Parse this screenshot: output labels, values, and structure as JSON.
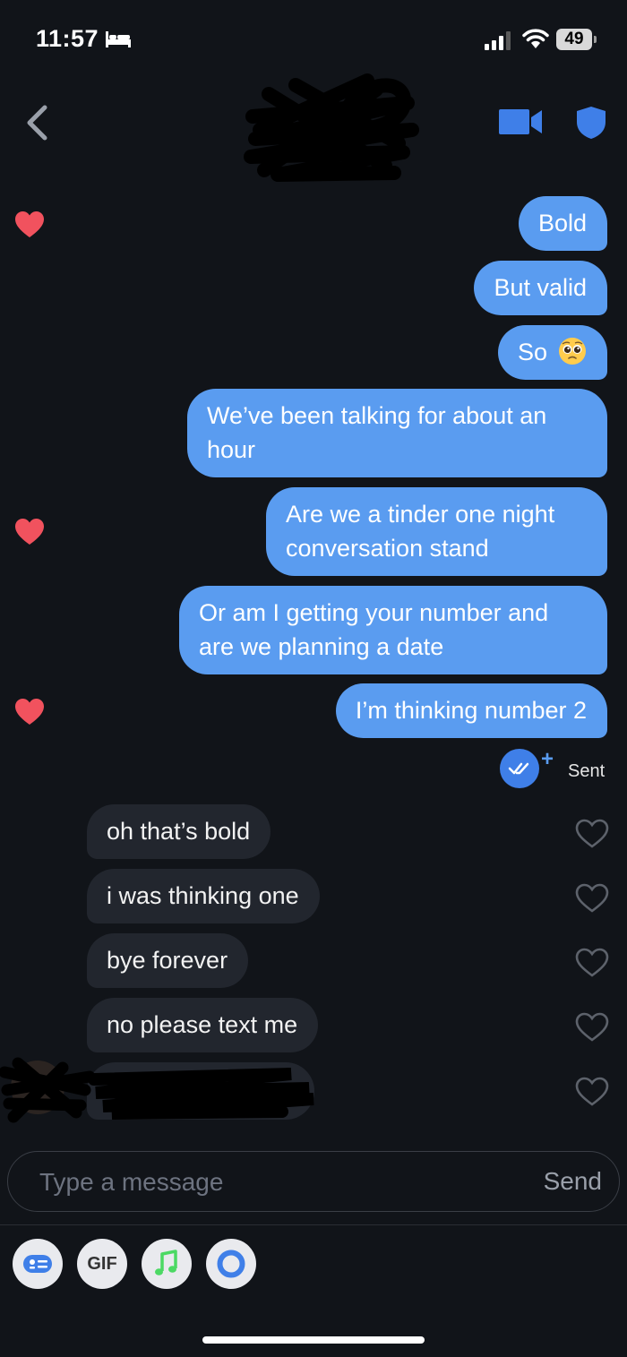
{
  "status_bar": {
    "time": "11:57",
    "battery": "49"
  },
  "colors": {
    "background": "#111419",
    "sent_bubble": "#5a9cf0",
    "received_bubble": "#22262e",
    "liked_heart": "#f1525e",
    "accent_blue": "#3f7fe8"
  },
  "header": {
    "icons": [
      "back-icon",
      "video-call-icon",
      "safety-shield-icon"
    ]
  },
  "messages_sent": [
    {
      "text": "Bold",
      "liked": true
    },
    {
      "text": "But valid",
      "liked": false
    },
    {
      "text": "So",
      "emoji": "pleading-face",
      "liked": false
    },
    {
      "text": "We’ve been talking for about an hour",
      "liked": false
    },
    {
      "text": "Are we a tinder one night conversation stand",
      "liked": true
    },
    {
      "text": "Or am I getting your number and are we planning a date",
      "liked": false
    },
    {
      "text": "I’m thinking number 2",
      "liked": true
    }
  ],
  "read_receipt": {
    "status": "Sent",
    "icon": "double-check-icon"
  },
  "messages_received": [
    {
      "text": "oh that’s bold",
      "liked": false
    },
    {
      "text": "i was thinking one",
      "liked": false
    },
    {
      "text": "bye forever",
      "liked": false
    },
    {
      "text": "no please text me",
      "liked": false
    }
  ],
  "composer": {
    "placeholder": "Type a message",
    "send_label": "Send"
  },
  "toolbar": {
    "gif_label": "GIF",
    "icons": [
      "sticker-icon",
      "gif-icon",
      "music-icon",
      "ring-icon"
    ]
  }
}
